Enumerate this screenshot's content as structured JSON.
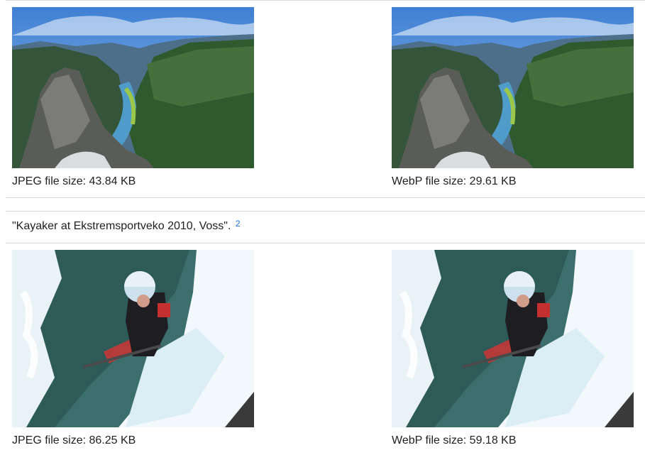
{
  "comparisons": [
    {
      "jpeg_caption": "JPEG file size: 43.84 KB",
      "webp_caption": "WebP file size: 29.61 KB",
      "image_subject": "fjord-landscape"
    },
    {
      "attribution_text": "\"Kayaker at Ekstremsportveko 2010, Voss\".",
      "footnote_ref": "2",
      "jpeg_caption": "JPEG file size: 86.25 KB",
      "webp_caption": "WebP file size: 59.18 KB",
      "image_subject": "kayaker-whitewater"
    }
  ],
  "colors": {
    "divider": "#dadce0",
    "footnote_link": "#1a73e8",
    "text": "#202124"
  }
}
